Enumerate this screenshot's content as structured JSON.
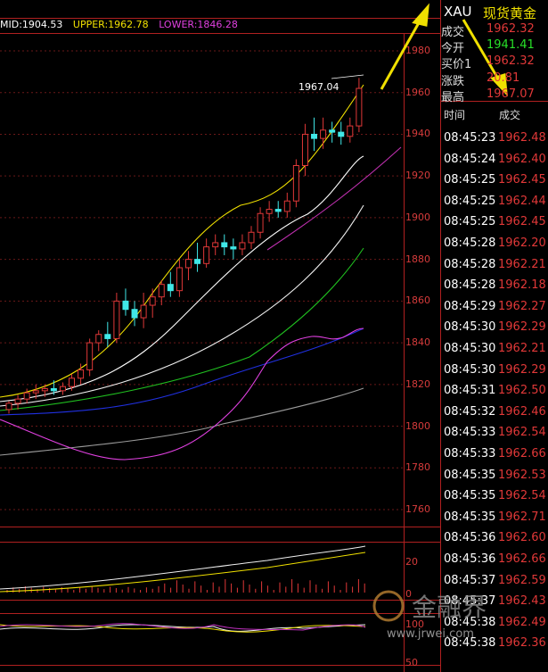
{
  "indicator": {
    "mid_label": "MID:1904.53",
    "upper_label": "UPPER:1962.78",
    "lower_label": "LOWER:1846.28",
    "colors": {
      "mid": "#ffffff",
      "upper": "#f0e000",
      "lower": "#e040e0"
    }
  },
  "price_axis": [
    "1980",
    "1960",
    "1940",
    "1920",
    "1900",
    "1880",
    "1860",
    "1840",
    "1820",
    "1800",
    "1780",
    "1760"
  ],
  "sub_axis_1": [
    "20",
    "0"
  ],
  "sub_axis_2": [
    "100",
    "50"
  ],
  "high_annotation": "1967.04",
  "quote": {
    "symbol": "XAU",
    "name": "现货黄金",
    "rows": [
      {
        "label": "成交",
        "value": "1962.32",
        "color": "#e03838"
      },
      {
        "label": "今开",
        "value": "1941.41",
        "color": "#28e028"
      },
      {
        "label": "买价1",
        "value": "1962.32",
        "color": "#e03838"
      },
      {
        "label": "涨跌",
        "value": "20.81",
        "color": "#e03838"
      },
      {
        "label": "最高",
        "value": "1967.07",
        "color": "#e03838"
      }
    ]
  },
  "ticks": {
    "time_header": "时间",
    "price_header": "成交",
    "rows": [
      {
        "time": "08:45:23",
        "price": "1962.48"
      },
      {
        "time": "08:45:24",
        "price": "1962.40"
      },
      {
        "time": "08:45:25",
        "price": "1962.45"
      },
      {
        "time": "08:45:25",
        "price": "1962.44"
      },
      {
        "time": "08:45:25",
        "price": "1962.45"
      },
      {
        "time": "08:45:28",
        "price": "1962.20"
      },
      {
        "time": "08:45:28",
        "price": "1962.21"
      },
      {
        "time": "08:45:28",
        "price": "1962.18"
      },
      {
        "time": "08:45:29",
        "price": "1962.27"
      },
      {
        "time": "08:45:30",
        "price": "1962.29"
      },
      {
        "time": "08:45:30",
        "price": "1962.21"
      },
      {
        "time": "08:45:30",
        "price": "1962.29"
      },
      {
        "time": "08:45:31",
        "price": "1962.50"
      },
      {
        "time": "08:45:32",
        "price": "1962.46"
      },
      {
        "time": "08:45:33",
        "price": "1962.54"
      },
      {
        "time": "08:45:33",
        "price": "1962.66"
      },
      {
        "time": "08:45:35",
        "price": "1962.53"
      },
      {
        "time": "08:45:35",
        "price": "1962.54"
      },
      {
        "time": "08:45:35",
        "price": "1962.71"
      },
      {
        "time": "08:45:36",
        "price": "1962.60"
      },
      {
        "time": "08:45:36",
        "price": "1962.66"
      },
      {
        "time": "08:45:37",
        "price": "1962.59"
      },
      {
        "time": "08:45:37",
        "price": "1962.43"
      },
      {
        "time": "08:45:38",
        "price": "1962.49"
      },
      {
        "time": "08:45:38",
        "price": "1962.36"
      }
    ]
  },
  "watermark": {
    "brand": "金融界",
    "url": "www.jrwei.com"
  },
  "chart_data": {
    "type": "candlestick",
    "ylim": [
      1755,
      1985
    ],
    "candles": [
      [
        1808,
        1812,
        1806,
        1811
      ],
      [
        1811,
        1815,
        1808,
        1813
      ],
      [
        1813,
        1818,
        1811,
        1816
      ],
      [
        1816,
        1820,
        1813,
        1817
      ],
      [
        1817,
        1820,
        1814,
        1818
      ],
      [
        1818,
        1822,
        1815,
        1817
      ],
      [
        1817,
        1821,
        1815,
        1819
      ],
      [
        1819,
        1825,
        1817,
        1823
      ],
      [
        1823,
        1830,
        1820,
        1827
      ],
      [
        1827,
        1842,
        1824,
        1840
      ],
      [
        1840,
        1846,
        1836,
        1844
      ],
      [
        1844,
        1850,
        1838,
        1842
      ],
      [
        1842,
        1864,
        1840,
        1860
      ],
      [
        1860,
        1866,
        1853,
        1856
      ],
      [
        1856,
        1860,
        1848,
        1852
      ],
      [
        1852,
        1864,
        1847,
        1858
      ],
      [
        1858,
        1866,
        1852,
        1862
      ],
      [
        1862,
        1870,
        1858,
        1868
      ],
      [
        1868,
        1874,
        1862,
        1865
      ],
      [
        1865,
        1880,
        1862,
        1876
      ],
      [
        1876,
        1884,
        1870,
        1880
      ],
      [
        1880,
        1888,
        1874,
        1878
      ],
      [
        1878,
        1890,
        1876,
        1886
      ],
      [
        1886,
        1892,
        1882,
        1888
      ],
      [
        1888,
        1892,
        1882,
        1886
      ],
      [
        1886,
        1890,
        1880,
        1885
      ],
      [
        1885,
        1892,
        1882,
        1888
      ],
      [
        1888,
        1896,
        1885,
        1893
      ],
      [
        1893,
        1905,
        1890,
        1902
      ],
      [
        1902,
        1908,
        1898,
        1904
      ],
      [
        1904,
        1908,
        1900,
        1903
      ],
      [
        1903,
        1912,
        1900,
        1908
      ],
      [
        1908,
        1928,
        1905,
        1925
      ],
      [
        1925,
        1945,
        1920,
        1940
      ],
      [
        1940,
        1948,
        1932,
        1938
      ],
      [
        1938,
        1948,
        1933,
        1942
      ],
      [
        1942,
        1946,
        1936,
        1941
      ],
      [
        1941,
        1946,
        1935,
        1939
      ],
      [
        1939,
        1948,
        1936,
        1944
      ],
      [
        1944,
        1967,
        1941,
        1962
      ]
    ]
  }
}
